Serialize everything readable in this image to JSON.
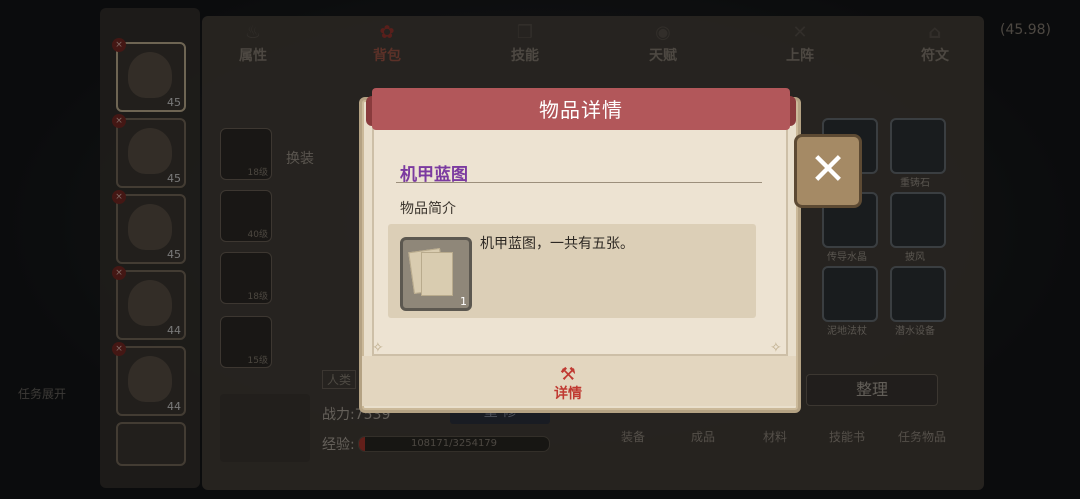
{
  "tabs": [
    {
      "label": "属性",
      "icon": "flame-icon",
      "active": false
    },
    {
      "label": "背包",
      "icon": "backpack-icon",
      "active": true
    },
    {
      "label": "技能",
      "icon": "book-icon",
      "active": false
    },
    {
      "label": "天赋",
      "icon": "eye-icon",
      "active": false
    },
    {
      "label": "上阵",
      "icon": "crossed-swords-icon",
      "active": false
    },
    {
      "label": "符文",
      "icon": "shrine-icon",
      "active": false
    }
  ],
  "roster": [
    {
      "level": "45"
    },
    {
      "level": "45"
    },
    {
      "level": "45"
    },
    {
      "level": "44"
    },
    {
      "level": "44"
    }
  ],
  "hero": {
    "change_outfit": "换装",
    "race_tag": "人类",
    "power_label": "战力:7539",
    "rebuild_label": "重 修",
    "exp_label": "经验:",
    "exp_value": "108171/3254179",
    "exp_progress": 0.033
  },
  "equipment_levels": [
    "18级",
    "40级",
    "18级",
    "15级"
  ],
  "inventory": {
    "visible_labels": [
      "重铸石",
      "传导水晶",
      "披风",
      "泥地法杖",
      "潜水设备"
    ],
    "sort_button": "整理",
    "categories": [
      "装备",
      "成品",
      "材料",
      "技能书",
      "任务物品"
    ]
  },
  "top_right_value": "(45.98)",
  "side_hint": "任务展开",
  "dialog": {
    "banner_title": "物品详情",
    "item_name": "机甲蓝图",
    "intro_label": "物品简介",
    "item_count": "1",
    "description": "机甲蓝图，一共有五张。",
    "detail_button": "详情",
    "close_icon": "close-x-icon",
    "colors": {
      "banner": "#b2575a",
      "item_name": "#7b3aa0",
      "detail": "#c03a32"
    }
  }
}
